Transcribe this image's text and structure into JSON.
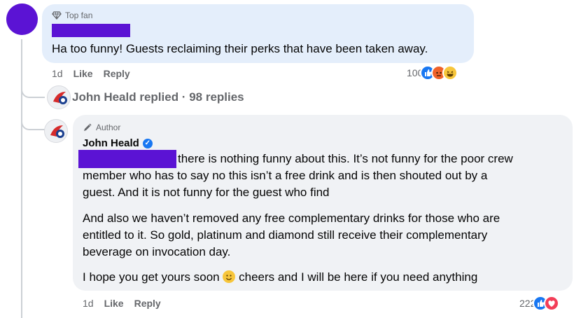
{
  "comment1": {
    "badge": "Top fan",
    "text": "Ha too funny! Guests reclaiming their perks that have been taken away.",
    "time": "1d",
    "like_label": "Like",
    "reply_label": "Reply",
    "reaction_count": "100",
    "reactions": [
      "like",
      "angry",
      "haha"
    ]
  },
  "reply_summary": {
    "text": "John Heald replied · 98 replies"
  },
  "reply": {
    "badge": "Author",
    "name": "John Heald",
    "line1": "there is nothing funny about this. It’s not funny for the poor crew",
    "line2": "member who has to say no this isn’t a free drink and is then shouted out by a",
    "line3": "guest. And it is not funny for the guest who find",
    "para2_line1": "And also we haven’t removed any free complementary drinks for those who are",
    "para2_line2": "entitled to it. So gold, platinum and diamond still receive their complementary",
    "para2_line3": "beverage on invocation day.",
    "para3_before": "I hope you get yours soon",
    "para3_after": "cheers and I will be here if you need anything",
    "time": "1d",
    "like_label": "Like",
    "reply_label": "Reply",
    "reaction_count": "222",
    "reactions": [
      "like",
      "love"
    ]
  },
  "colors": {
    "bubble_top_fan": "#e4eefb",
    "bubble_reply": "#f0f2f5",
    "redaction": "#5b13d4",
    "like_blue": "#1877f2"
  }
}
